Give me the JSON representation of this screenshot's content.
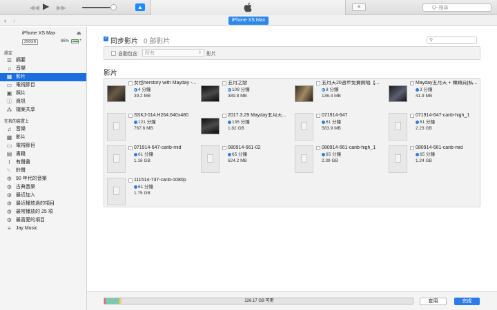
{
  "toolbar": {
    "prev_icon": "rewind-icon",
    "play_icon": "play-icon",
    "next_icon": "fast-forward-icon",
    "volume_percent": 82,
    "search_placeholder": "Q~搜尋"
  },
  "nav": {
    "device_pill": "iPhone XS Max"
  },
  "device": {
    "name": "iPhone XS Max",
    "capacity": "256GB",
    "battery_pct": "86%",
    "battery_level": 0.86
  },
  "sidebar": {
    "settings_header": "設定",
    "settings_items": [
      {
        "label": "摘要",
        "icon": "summary-icon"
      },
      {
        "label": "音樂",
        "icon": "music-note-icon"
      },
      {
        "label": "影片",
        "icon": "film-icon"
      },
      {
        "label": "電視節目",
        "icon": "tv-icon"
      },
      {
        "label": "照片",
        "icon": "camera-icon"
      },
      {
        "label": "資訊",
        "icon": "info-icon"
      },
      {
        "label": "檔案共享",
        "icon": "file-sharing-icon"
      }
    ],
    "ondevice_header": "在我的裝置上",
    "ondevice_items": [
      {
        "label": "音樂",
        "icon": "music-note-icon"
      },
      {
        "label": "影片",
        "icon": "film-icon"
      },
      {
        "label": "電視節目",
        "icon": "tv-icon"
      },
      {
        "label": "書籍",
        "icon": "book-icon"
      },
      {
        "label": "有聲書",
        "icon": "audiobook-icon"
      },
      {
        "label": "鈴聲",
        "icon": "bell-icon"
      },
      {
        "label": "90 年代的音樂",
        "icon": "gear-playlist-icon"
      },
      {
        "label": "古典音樂",
        "icon": "gear-playlist-icon"
      },
      {
        "label": "最近加入",
        "icon": "gear-playlist-icon"
      },
      {
        "label": "最近播放過的項目",
        "icon": "gear-playlist-icon"
      },
      {
        "label": "最常播放的 25 項",
        "icon": "gear-playlist-icon"
      },
      {
        "label": "最喜愛的項目",
        "icon": "gear-playlist-icon"
      },
      {
        "label": "Jay Music",
        "icon": "playlist-icon"
      }
    ]
  },
  "main": {
    "sync_label": "同步影片",
    "sync_count": "0 部影片",
    "auto_include_label": "自動包含",
    "auto_include_value": "所有",
    "auto_include_suffix": "影片",
    "movies_heading": "影片",
    "movies": [
      {
        "title": "女也herstory with Mayday -...",
        "duration": "4 分鐘",
        "size": "39.2 MB",
        "dot": "half",
        "thumb": "photo"
      },
      {
        "title": "五月之戀",
        "duration": "109 分鐘",
        "size": "389.8 MB",
        "dot": "half",
        "thumb": "photo v2"
      },
      {
        "title": "五月天20週年免費開唱【...",
        "duration": "8 分鐘",
        "size": "136.4 MB",
        "dot": "half",
        "thumb": "photo v3"
      },
      {
        "title": "Mayday五月天 + 陳綺貞[私...",
        "duration": "3 分鐘",
        "size": "41.9 MB",
        "dot": "full",
        "thumb": "photo v4"
      },
      {
        "title": "SSKJ-014.H264.640x480",
        "duration": "121 分鐘",
        "size": "767.6 MB",
        "dot": "full",
        "thumb": "blank"
      },
      {
        "title": "2017.3.29 Mayday五月天...",
        "duration": "135 分鐘",
        "size": "1.82 GB",
        "dot": "full",
        "thumb": "photo v2"
      },
      {
        "title": "071914-647",
        "duration": "61 分鐘",
        "size": "583.9 MB",
        "dot": "full",
        "thumb": "blank"
      },
      {
        "title": "071914-647-carib-high_1",
        "duration": "61 分鐘",
        "size": "2.23 GB",
        "dot": "full",
        "thumb": "blank"
      },
      {
        "title": "071914-647-carib-mid",
        "duration": "61 分鐘",
        "size": "1.16 GB",
        "dot": "full",
        "thumb": "blank"
      },
      {
        "title": "080914-661-02",
        "duration": "65 分鐘",
        "size": "624.2 MB",
        "dot": "full",
        "thumb": "blank"
      },
      {
        "title": "080914-661-carib-high_1",
        "duration": "65 分鐘",
        "size": "2.39 GB",
        "dot": "full",
        "thumb": "blank"
      },
      {
        "title": "080914-661-carib-mid",
        "duration": "65 分鐘",
        "size": "1.24 GB",
        "dot": "full",
        "thumb": "blank"
      },
      {
        "title": "111514-737-carib-1080p",
        "duration": "61 分鐘",
        "size": "1.75 GB",
        "dot": "full",
        "thumb": "blank"
      }
    ]
  },
  "storage": {
    "label": "226.17 GB 可用",
    "segments": [
      {
        "color": "#e8667a",
        "fraction": 0.004
      },
      {
        "color": "#7fc8b0",
        "fraction": 0.044
      },
      {
        "color": "#f2d16b",
        "fraction": 0.006
      }
    ]
  },
  "footer": {
    "apply_label": "套用",
    "done_label": "完成"
  },
  "colors": {
    "accent": "#2b7ce9",
    "selected": "#1b6ee0"
  }
}
